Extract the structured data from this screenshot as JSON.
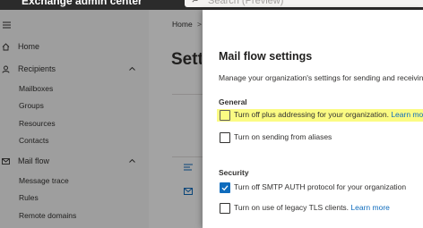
{
  "topbar": {
    "app_title": "Exchange admin center",
    "search_placeholder": "Search (Preview)"
  },
  "sidebar": {
    "home": "Home",
    "recipients": "Recipients",
    "recipients_sub": [
      "Mailboxes",
      "Groups",
      "Resources",
      "Contacts"
    ],
    "mail_flow": "Mail flow",
    "mail_flow_sub": [
      "Message trace",
      "Rules",
      "Remote domains"
    ]
  },
  "main": {
    "breadcrumb_home": "Home",
    "breadcrumb_sep": ">",
    "page_title": "Settings"
  },
  "panel": {
    "title": "Mail flow settings",
    "description": "Manage your organization's settings for sending and receiving",
    "general_heading": "General",
    "general_options": [
      {
        "label": "Turn off plus addressing for your organization.",
        "link": "Learn mo",
        "checked": false,
        "highlighted": true
      },
      {
        "label": "Turn on sending from aliases",
        "link": "",
        "checked": false,
        "highlighted": false
      }
    ],
    "security_heading": "Security",
    "security_options": [
      {
        "label": "Turn off SMTP AUTH protocol for your organization",
        "link": "",
        "checked": true,
        "highlighted": false
      },
      {
        "label": "Turn on use of legacy TLS clients.",
        "link": "Learn more",
        "checked": false,
        "highlighted": false
      }
    ]
  },
  "colors": {
    "accent": "#0f6cbd",
    "highlight": "#fbfb83",
    "topbar": "#2b2b2b"
  }
}
